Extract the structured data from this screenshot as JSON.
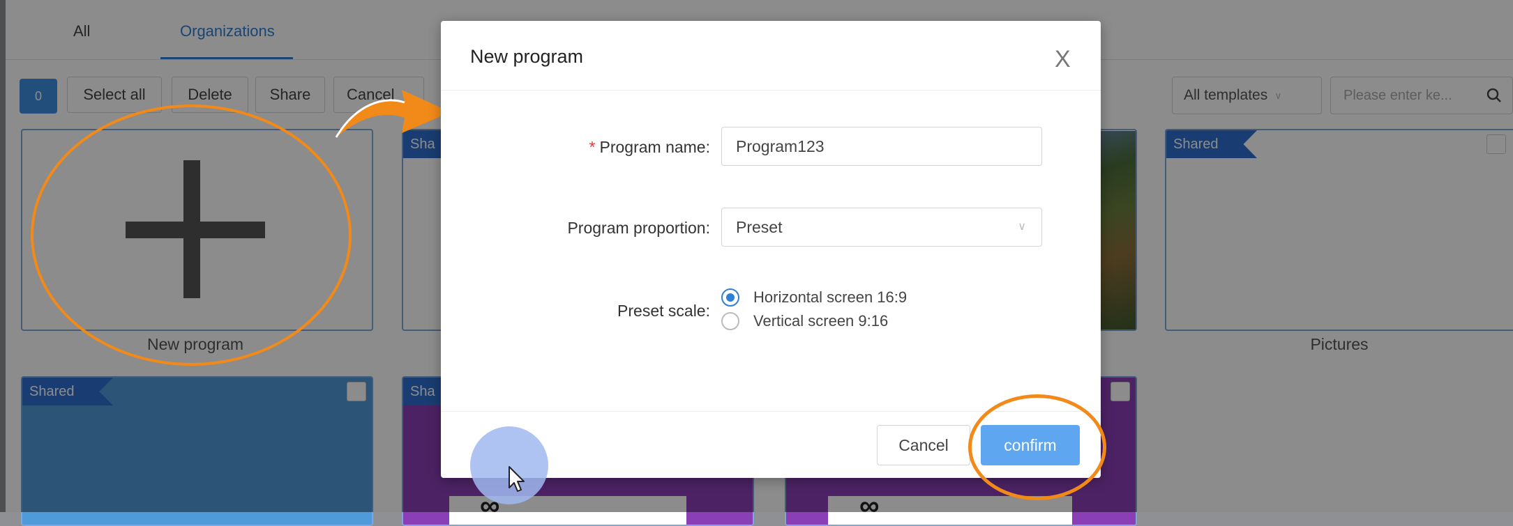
{
  "tabs": [
    {
      "label": "All"
    },
    {
      "label": "Organizations"
    }
  ],
  "toolbar": {
    "count": "0",
    "select_all": "Select all",
    "delete": "Delete",
    "share": "Share",
    "cancel": "Cancel",
    "template_filter": "All templates",
    "search_placeholder": "Please enter ke..."
  },
  "cards": {
    "new_program_label": "New program",
    "shared_tag": "Shared",
    "shared_tag_short": "Sha",
    "pictures_label": "Pictures",
    "infinity_glyph": "∞"
  },
  "modal": {
    "title": "New program",
    "close_glyph": "X",
    "fields": {
      "name_label": "Program name:",
      "name_required_mark": "*",
      "name_value": "Program123",
      "proportion_label": "Program proportion:",
      "proportion_value": "Preset",
      "preset_scale_label": "Preset scale:",
      "options": [
        {
          "label": "Horizontal screen 16:9",
          "checked": true
        },
        {
          "label": "Vertical screen 9:16",
          "checked": false
        }
      ]
    },
    "cancel": "Cancel",
    "confirm": "confirm"
  },
  "colors": {
    "accent": "#2f7fd6",
    "confirm_button": "#5fa6f0",
    "annotation": "#f28a19",
    "shared_tag": "#2f6fd0"
  },
  "icons": {
    "search": "search-icon",
    "close": "close-icon",
    "chevron": "chevron-down-icon",
    "plus": "plus-icon",
    "cursor": "mouse-pointer-icon",
    "arrow": "annotation-arrow"
  }
}
